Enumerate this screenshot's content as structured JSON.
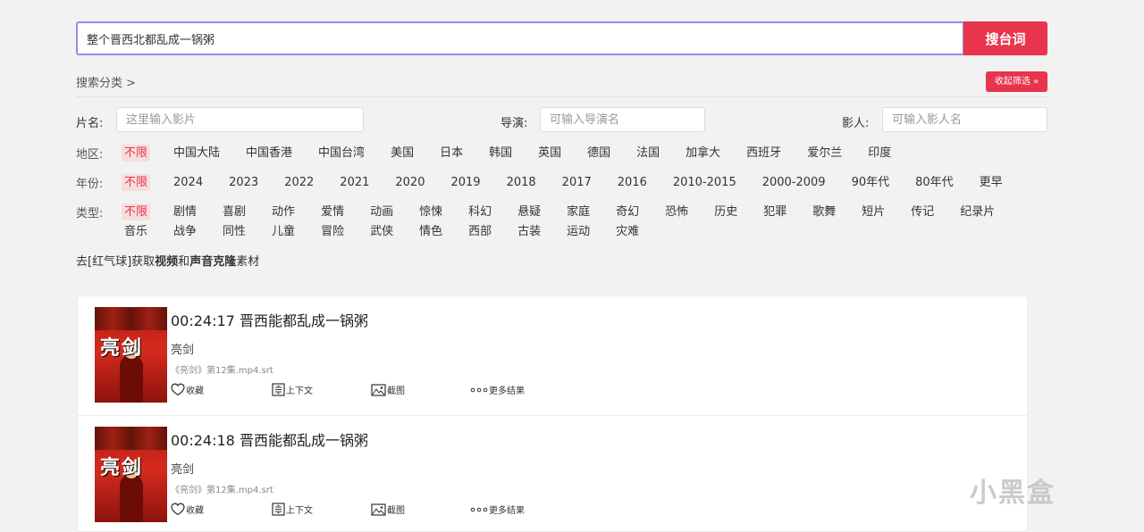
{
  "search": {
    "value": "整个晋西北都乱成一锅粥",
    "button_label": "搜台词"
  },
  "category_label": "搜索分类 >",
  "collapse_label": "收起筛选 »",
  "fields": {
    "title": {
      "label": "片名:",
      "placeholder": "这里输入影片"
    },
    "director": {
      "label": "导演:",
      "placeholder": "可输入导演名"
    },
    "actor": {
      "label": "影人:",
      "placeholder": "可输入影人名"
    }
  },
  "filters": {
    "region": {
      "label": "地区:",
      "options": [
        "不限",
        "中国大陆",
        "中国香港",
        "中国台湾",
        "美国",
        "日本",
        "韩国",
        "英国",
        "德国",
        "法国",
        "加拿大",
        "西班牙",
        "爱尔兰",
        "印度"
      ]
    },
    "year": {
      "label": "年份:",
      "options": [
        "不限",
        "2024",
        "2023",
        "2022",
        "2021",
        "2020",
        "2019",
        "2018",
        "2017",
        "2016",
        "2010-2015",
        "2000-2009",
        "90年代",
        "80年代",
        "更早"
      ]
    },
    "genre": {
      "label": "类型:",
      "options": [
        "不限",
        "剧情",
        "喜剧",
        "动作",
        "爱情",
        "动画",
        "惊悚",
        "科幻",
        "悬疑",
        "家庭",
        "奇幻",
        "恐怖",
        "历史",
        "犯罪",
        "歌舞",
        "短片",
        "传记",
        "纪录片",
        "音乐",
        "战争",
        "同性",
        "儿童",
        "冒险",
        "武侠",
        "情色",
        "西部",
        "古装",
        "运动",
        "灾难"
      ]
    }
  },
  "promo": {
    "prefix": "去[红气球]获取",
    "bold1": "视频",
    "mid": "和",
    "bold2": "声音克隆",
    "suffix": "素材"
  },
  "results": [
    {
      "time": "00:24:17",
      "line": "晋西能都乱成一锅粥",
      "show": "亮剑",
      "file": "《亮剑》第12集.mp4.srt",
      "thumb_title": "亮剑",
      "actions": {
        "favorite": "收藏",
        "context": "上下文",
        "screenshot": "截图",
        "more": "更多结果"
      }
    },
    {
      "time": "00:24:18",
      "line": "晋西能都乱成一锅粥",
      "show": "亮剑",
      "file": "《亮剑》第12集.mp4.srt",
      "thumb_title": "亮剑",
      "actions": {
        "favorite": "收藏",
        "context": "上下文",
        "screenshot": "截图",
        "more": "更多结果"
      }
    }
  ],
  "watermark": "小黑盒",
  "colors": {
    "accent": "#e8344c",
    "active_bg": "#f6dede",
    "search_border": "#8f8fe8"
  }
}
